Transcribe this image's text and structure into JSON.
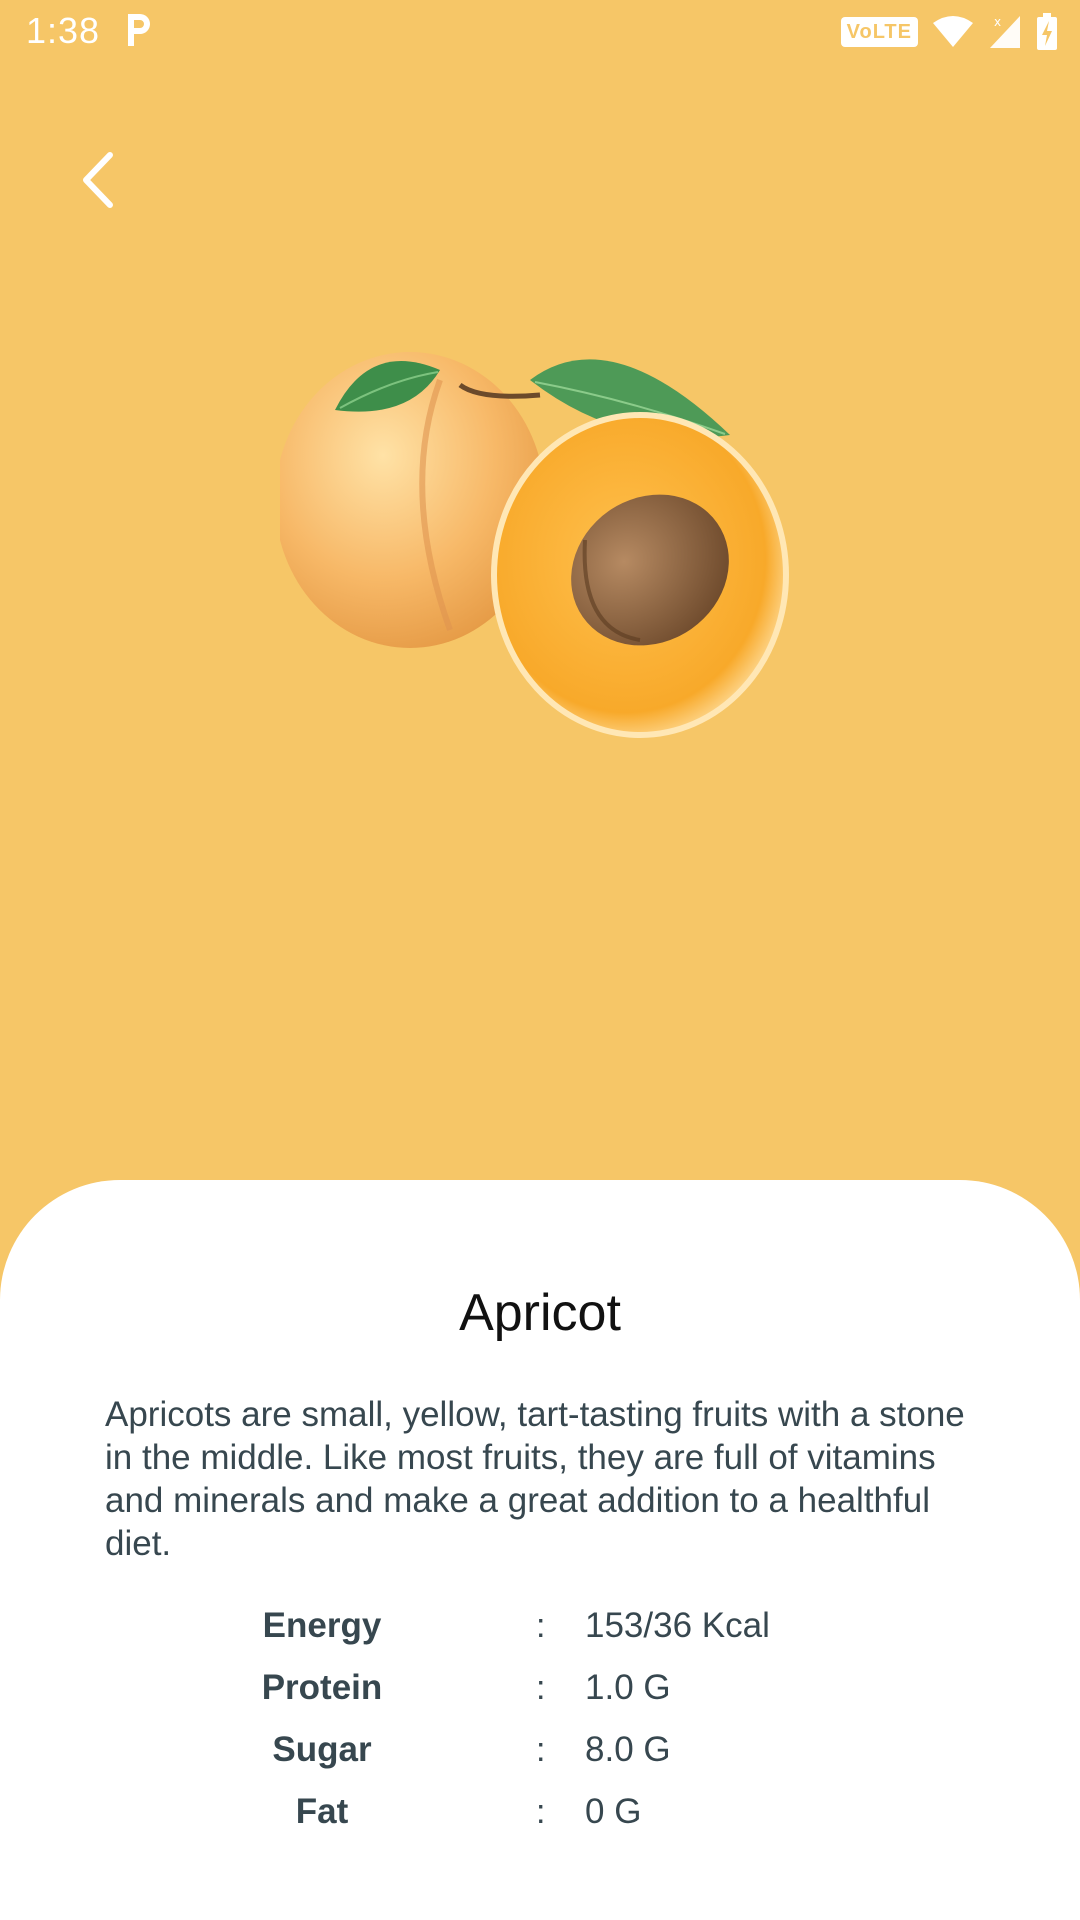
{
  "status_bar": {
    "time": "1:38",
    "app_icon": "p-icon",
    "network_label": "VoLTE",
    "icons": [
      "wifi-icon",
      "signal-icon",
      "battery-charging-icon"
    ]
  },
  "header": {
    "back_icon": "chevron-left-icon"
  },
  "fruit": {
    "name": "Apricot",
    "description": "Apricots are small, yellow, tart-tasting fruits with a stone in the middle. Like most fruits, they are full of vitamins and minerals and make a great addition to a healthful diet.",
    "image": "apricot-image"
  },
  "nutrition": [
    {
      "label": "Energy",
      "separator": ":",
      "value": "153/36 Kcal"
    },
    {
      "label": "Protein",
      "separator": ":",
      "value": "1.0 G"
    },
    {
      "label": "Sugar",
      "separator": ":",
      "value": "8.0 G"
    },
    {
      "label": "Fat",
      "separator": ":",
      "value": "0 G"
    }
  ],
  "colors": {
    "background": "#F6C667",
    "sheet": "#FFFFFF",
    "text": "#37474F",
    "title": "#111111"
  }
}
